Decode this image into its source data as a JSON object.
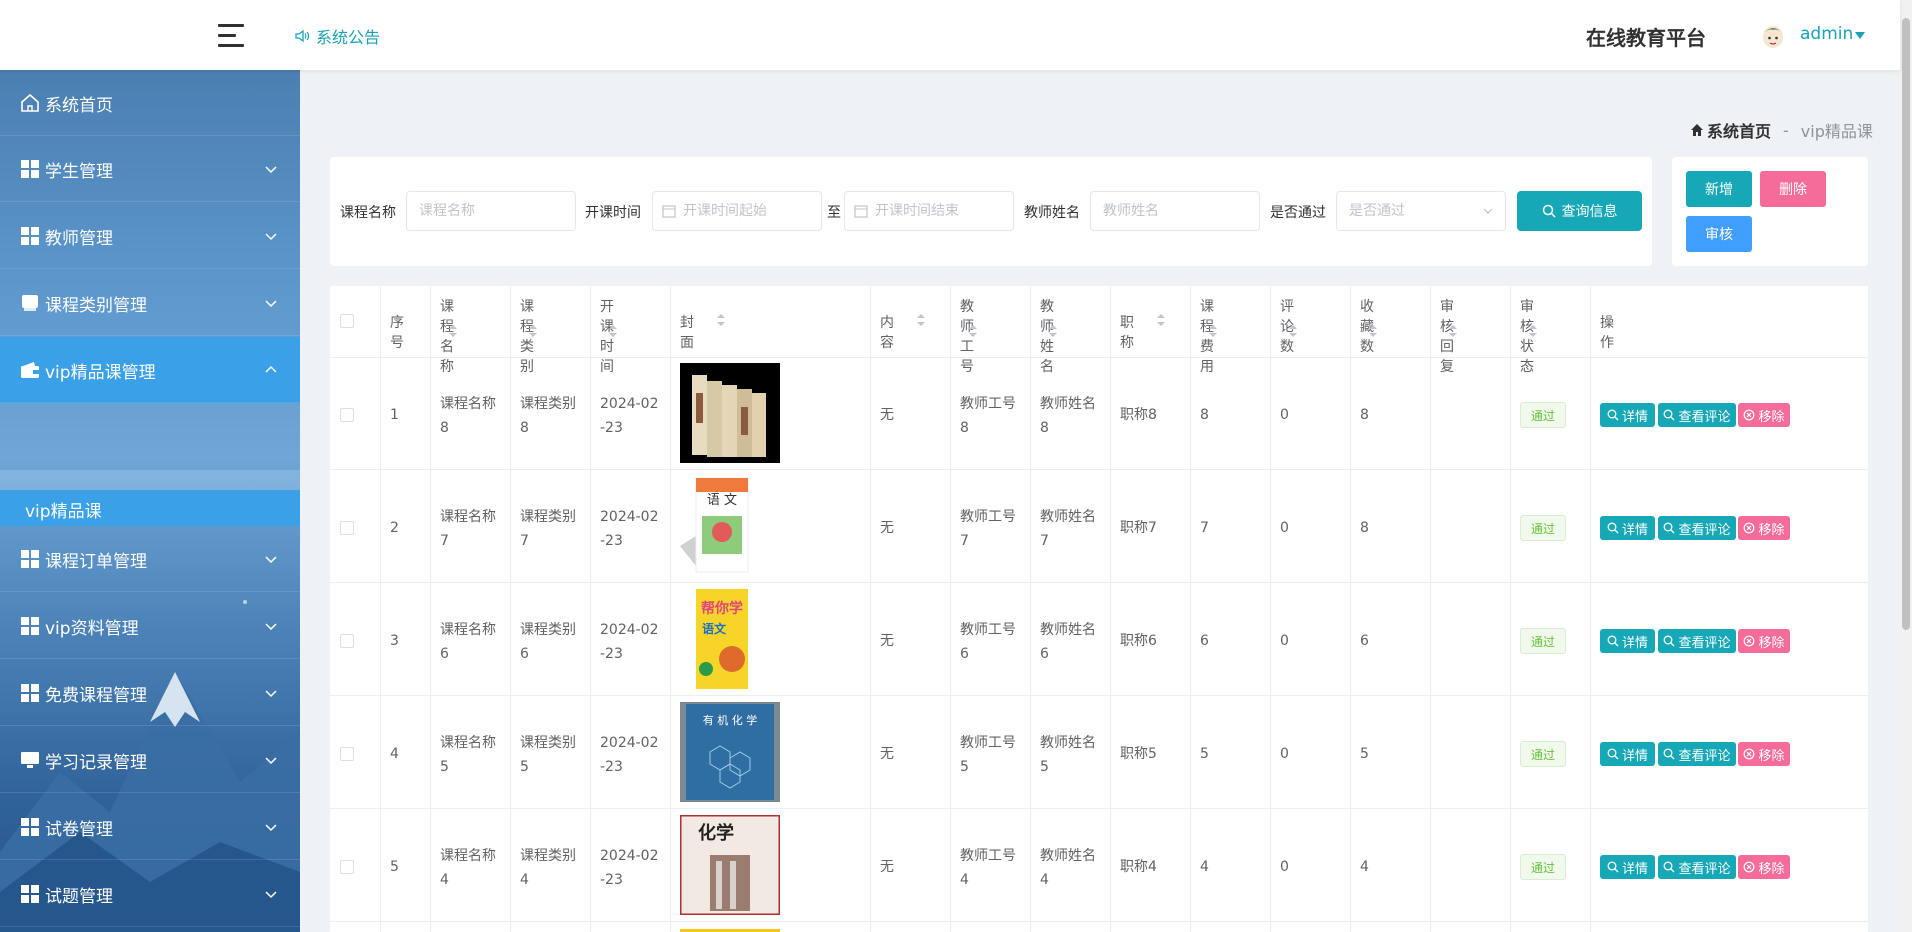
{
  "header": {
    "notice": "系统公告",
    "site_title": "在线教育平台",
    "user_name": "admin"
  },
  "sidebar": {
    "items": [
      {
        "label": "系统首页",
        "icon": "home-icon"
      },
      {
        "label": "学生管理",
        "icon": "grid-icon"
      },
      {
        "label": "教师管理",
        "icon": "grid-icon"
      },
      {
        "label": "课程类别管理",
        "icon": "book-icon"
      },
      {
        "label": "vip精品课管理",
        "icon": "wallet-icon"
      },
      {
        "label": "课程订单管理",
        "icon": "grid-icon"
      },
      {
        "label": "vip资料管理",
        "icon": "grid-icon"
      },
      {
        "label": "免费课程管理",
        "icon": "grid-icon"
      },
      {
        "label": "学习记录管理",
        "icon": "monitor-icon"
      },
      {
        "label": "试卷管理",
        "icon": "grid-icon"
      },
      {
        "label": "试题管理",
        "icon": "grid-icon"
      }
    ],
    "active_sub": "vip精品课"
  },
  "breadcrumb": {
    "home": "系统首页",
    "separator": "-",
    "current": "vip精品课"
  },
  "search": {
    "course_name_label": "课程名称",
    "course_name_placeholder": "课程名称",
    "open_time_label": "开课时间",
    "start_placeholder": "开课时间起始",
    "to_label": "至",
    "end_placeholder": "开课时间结束",
    "teacher_name_label": "教师姓名",
    "teacher_name_placeholder": "教师姓名",
    "passed_label": "是否通过",
    "passed_placeholder": "是否通过",
    "query_button": "查询信息"
  },
  "actions": {
    "add": "新增",
    "delete": "删除",
    "audit": "审核"
  },
  "colors": {
    "primary": "#17a8b8",
    "danger": "#f56c9a",
    "audit": "#409eff",
    "menu_active": "#3aa0e8"
  },
  "table": {
    "columns": [
      "序号",
      "课程名称",
      "课程类别",
      "开课时间",
      "封面",
      "内容",
      "教师工号",
      "教师姓名",
      "职称",
      "课程费用",
      "评论数",
      "收藏数",
      "审核回复",
      "审核状态",
      "操作"
    ],
    "rows": [
      {
        "index": "1",
        "course_name": [
          "课程名称",
          "8"
        ],
        "category": [
          "课程类别",
          "8"
        ],
        "open_time": [
          "2024-02",
          "-23"
        ],
        "content": "无",
        "teacher_no": [
          "教师工号",
          "8"
        ],
        "teacher_name": [
          "教师姓名",
          "8"
        ],
        "title": "职称8",
        "fee": "8",
        "comments": "0",
        "favorites": "8",
        "reply": "",
        "status": "通过"
      },
      {
        "index": "2",
        "course_name": [
          "课程名称",
          "7"
        ],
        "category": [
          "课程类别",
          "7"
        ],
        "open_time": [
          "2024-02",
          "-23"
        ],
        "content": "无",
        "teacher_no": [
          "教师工号",
          "7"
        ],
        "teacher_name": [
          "教师姓名",
          "7"
        ],
        "title": "职称7",
        "fee": "7",
        "comments": "0",
        "favorites": "8",
        "reply": "",
        "status": "通过"
      },
      {
        "index": "3",
        "course_name": [
          "课程名称",
          "6"
        ],
        "category": [
          "课程类别",
          "6"
        ],
        "open_time": [
          "2024-02",
          "-23"
        ],
        "content": "无",
        "teacher_no": [
          "教师工号",
          "6"
        ],
        "teacher_name": [
          "教师姓名",
          "6"
        ],
        "title": "职称6",
        "fee": "6",
        "comments": "0",
        "favorites": "6",
        "reply": "",
        "status": "通过"
      },
      {
        "index": "4",
        "course_name": [
          "课程名称",
          "5"
        ],
        "category": [
          "课程类别",
          "5"
        ],
        "open_time": [
          "2024-02",
          "-23"
        ],
        "content": "无",
        "teacher_no": [
          "教师工号",
          "5"
        ],
        "teacher_name": [
          "教师姓名",
          "5"
        ],
        "title": "职称5",
        "fee": "5",
        "comments": "0",
        "favorites": "5",
        "reply": "",
        "status": "通过"
      },
      {
        "index": "5",
        "course_name": [
          "课程名称",
          "4"
        ],
        "category": [
          "课程类别",
          "4"
        ],
        "open_time": [
          "2024-02",
          "-23"
        ],
        "content": "无",
        "teacher_no": [
          "教师工号",
          "4"
        ],
        "teacher_name": [
          "教师姓名",
          "4"
        ],
        "title": "职称4",
        "fee": "4",
        "comments": "0",
        "favorites": "4",
        "reply": "",
        "status": "通过"
      }
    ],
    "ops": {
      "detail": "详情",
      "review": "查看评论",
      "remove": "移除"
    }
  }
}
